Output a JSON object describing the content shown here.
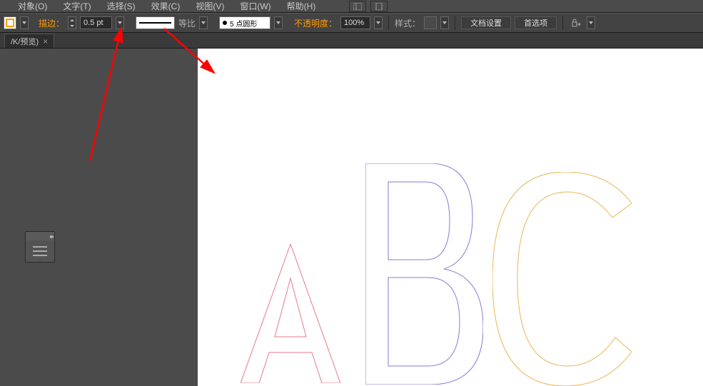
{
  "menubar": {
    "items": [
      "对象(O)",
      "文字(T)",
      "选择(S)",
      "效果(C)",
      "视图(V)",
      "窗口(W)",
      "帮助(H)"
    ]
  },
  "controlbar": {
    "stroke_label": "描边：",
    "stroke_weight": "0.5 pt",
    "profile_label": "等比",
    "brush_name": "5 点圆形",
    "opacity_label": "不透明度：",
    "opacity_value": "100%",
    "style_label": "样式：",
    "docsetup_label": "文档设置",
    "prefs_label": "首选项"
  },
  "tab": {
    "label": "/K/预览)",
    "close": "×"
  },
  "letters": {
    "a": "A",
    "b": "B",
    "c": "C"
  },
  "colors": {
    "arrow": "#ff0000",
    "letter_a": "#e97a89",
    "letter_b": "#8a7bd4",
    "letter_c": "#e8b655"
  }
}
